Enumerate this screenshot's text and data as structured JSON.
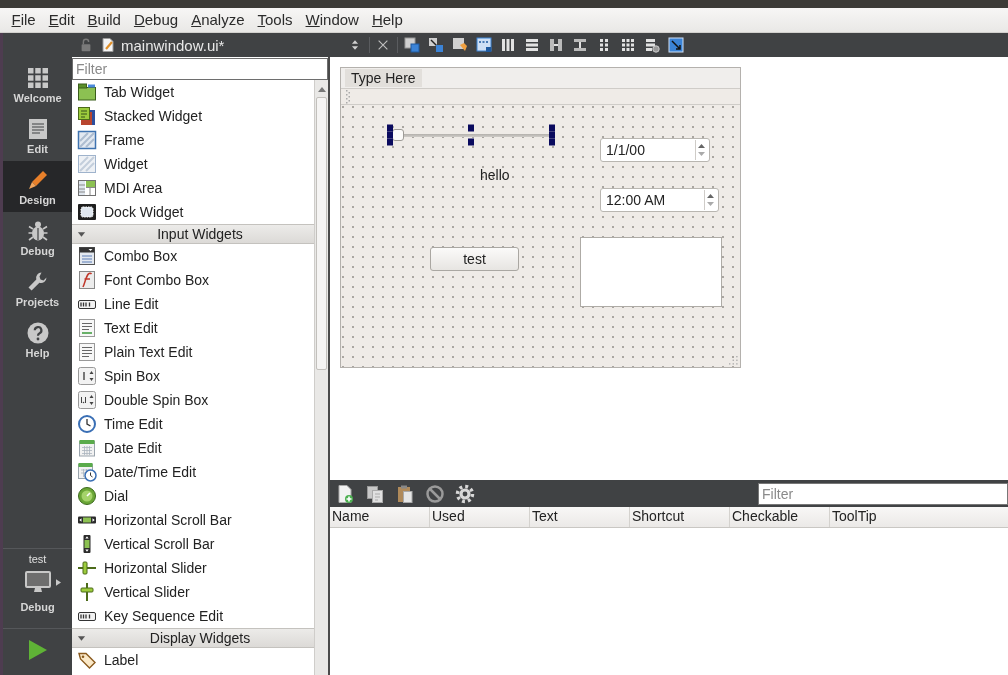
{
  "menu_bar": [
    "File",
    "Edit",
    "Build",
    "Debug",
    "Analyze",
    "Tools",
    "Window",
    "Help"
  ],
  "mode_bar": {
    "items": [
      {
        "label": "Welcome",
        "selected": false
      },
      {
        "label": "Edit",
        "selected": false
      },
      {
        "label": "Design",
        "selected": true
      },
      {
        "label": "Debug",
        "selected": false
      },
      {
        "label": "Projects",
        "selected": false
      },
      {
        "label": "Help",
        "selected": false
      }
    ],
    "kit": {
      "project": "test",
      "build": "Debug"
    }
  },
  "editor_toolbar": {
    "file_name": "mainwindow.ui*"
  },
  "widget_box": {
    "filter": {
      "placeholder": "Filter"
    },
    "items": [
      {
        "kind": "widget",
        "label": "Tab Widget"
      },
      {
        "kind": "widget",
        "label": "Stacked Widget"
      },
      {
        "kind": "widget",
        "label": "Frame"
      },
      {
        "kind": "widget",
        "label": "Widget"
      },
      {
        "kind": "widget",
        "label": "MDI Area"
      },
      {
        "kind": "widget",
        "label": "Dock Widget"
      },
      {
        "kind": "category",
        "label": "Input Widgets",
        "expanded": true
      },
      {
        "kind": "widget",
        "label": "Combo Box"
      },
      {
        "kind": "widget",
        "label": "Font Combo Box"
      },
      {
        "kind": "widget",
        "label": "Line Edit"
      },
      {
        "kind": "widget",
        "label": "Text Edit"
      },
      {
        "kind": "widget",
        "label": "Plain Text Edit"
      },
      {
        "kind": "widget",
        "label": "Spin Box"
      },
      {
        "kind": "widget",
        "label": "Double Spin Box"
      },
      {
        "kind": "widget",
        "label": "Time Edit"
      },
      {
        "kind": "widget",
        "label": "Date Edit"
      },
      {
        "kind": "widget",
        "label": "Date/Time Edit"
      },
      {
        "kind": "widget",
        "label": "Dial"
      },
      {
        "kind": "widget",
        "label": "Horizontal Scroll Bar"
      },
      {
        "kind": "widget",
        "label": "Vertical Scroll Bar"
      },
      {
        "kind": "widget",
        "label": "Horizontal Slider"
      },
      {
        "kind": "widget",
        "label": "Vertical Slider"
      },
      {
        "kind": "widget",
        "label": "Key Sequence Edit"
      },
      {
        "kind": "category",
        "label": "Display Widgets",
        "expanded": true
      },
      {
        "kind": "widget",
        "label": "Label"
      }
    ]
  },
  "form": {
    "menu_prompt": "Type Here",
    "widgets": [
      {
        "kind": "horizontal_slider",
        "selected": true,
        "level": 0
      },
      {
        "kind": "label",
        "text": "hello",
        "selected": false
      },
      {
        "kind": "date_edit",
        "value": "1/1/00",
        "selected": false
      },
      {
        "kind": "time_edit",
        "value": "12:00 AM",
        "selected": false
      },
      {
        "kind": "push_button",
        "text": "test",
        "selected": false
      },
      {
        "kind": "text_edit",
        "selected": false
      }
    ]
  },
  "action_editor": {
    "filter": {
      "placeholder": "Filter"
    },
    "columns": [
      "Name",
      "Used",
      "Text",
      "Shortcut",
      "Checkable",
      "ToolTip"
    ]
  }
}
